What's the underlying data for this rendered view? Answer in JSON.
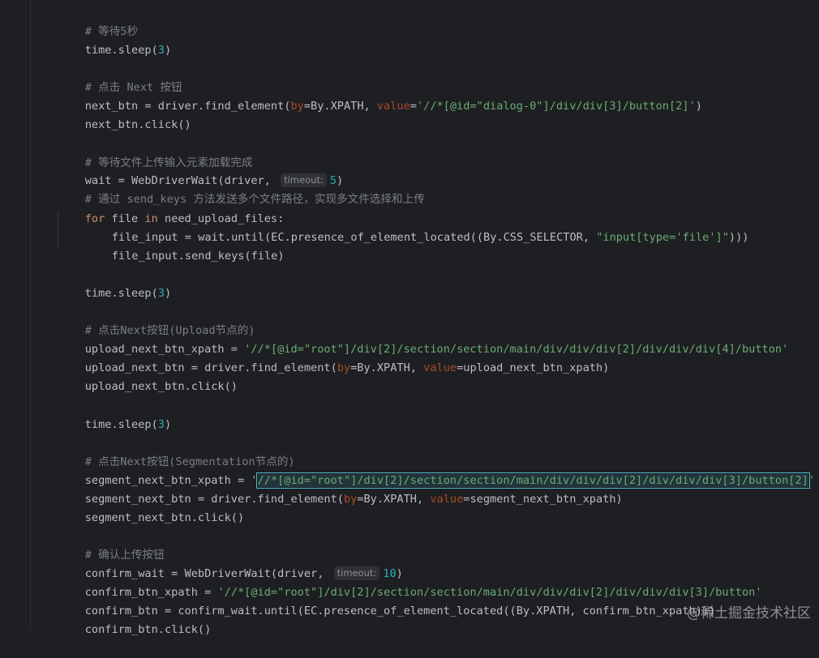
{
  "editor": {
    "lines": [
      {
        "parts": [
          "# 等待5秒"
        ]
      },
      {
        "parts": [
          "time.sleep(",
          "3",
          ")"
        ]
      },
      {
        "parts": [
          "# 点击 Next 按钮"
        ]
      },
      {
        "parts": [
          "next_btn = driver.find_element(",
          "by",
          "=By.XPATH, ",
          "value",
          "=",
          "'//*[@id=\"dialog-0\"]/div/div[3]/button[2]'",
          ")"
        ]
      },
      {
        "parts": [
          "next_btn.click()"
        ]
      },
      {
        "parts": [
          "# 等待文件上传输入元素加载完成"
        ]
      },
      {
        "parts": [
          "wait = WebDriverWait(driver, ",
          "timeout:",
          "5",
          ")"
        ]
      },
      {
        "parts": [
          "# 通过 send_keys 方法发送多个文件路径，实现多文件选择和上传"
        ]
      },
      {
        "parts": [
          "for",
          " file ",
          "in",
          " need_upload_files:"
        ]
      },
      {
        "parts": [
          "file_input = wait.until(EC.presence_of_element_located((By.CSS_SELECTOR, ",
          "\"input[type='file']\"",
          ")))"
        ]
      },
      {
        "parts": [
          "file_input.send_keys(file)"
        ]
      },
      {
        "parts": [
          "time.sleep(",
          "3",
          ")"
        ]
      },
      {
        "parts": [
          "# 点击Next按钮(Upload节点的)"
        ]
      },
      {
        "parts": [
          "upload_next_btn_xpath = ",
          "'//*[@id=\"root\"]/div[2]/section/section/main/div/div/div[2]/div/div/div[4]/button'"
        ]
      },
      {
        "parts": [
          "upload_next_btn = driver.find_element(",
          "by",
          "=By.XPATH, ",
          "value",
          "=upload_next_btn_xpath)"
        ]
      },
      {
        "parts": [
          "upload_next_btn.click()"
        ]
      },
      {
        "parts": [
          "time.sleep(",
          "3",
          ")"
        ]
      },
      {
        "parts": [
          "# 点击Next按钮(Segmentation节点的)"
        ]
      },
      {
        "parts": [
          "segment_next_btn_xpath = ",
          "'",
          "//*[@id=\"root\"]/div[2]/section/section/main/div/div/div[2]/div/div/div[3]/button[2]",
          "'"
        ]
      },
      {
        "parts": [
          "segment_next_btn = driver.find_element(",
          "by",
          "=By.XPATH, ",
          "value",
          "=segment_next_btn_xpath)"
        ]
      },
      {
        "parts": [
          "segment_next_btn.click()"
        ]
      },
      {
        "parts": [
          "# 确认上传按钮"
        ]
      },
      {
        "parts": [
          "confirm_wait = WebDriverWait(driver, ",
          "timeout:",
          "10",
          ")"
        ]
      },
      {
        "parts": [
          "confirm_btn_xpath = ",
          "'//*[@id=\"root\"]/div[2]/section/section/main/div/div/div[2]/div/div/div[3]/button'"
        ]
      },
      {
        "parts": [
          "confirm_btn = confirm_wait.until(EC.presence_of_element_located((By.XPATH, confirm_btn_xpath)))"
        ]
      },
      {
        "parts": [
          "confirm_btn.click()"
        ]
      }
    ]
  },
  "watermark": {
    "text": "@稀土掘金技术社区"
  },
  "colors": {
    "background": "#1e1f22",
    "text": "#bcbec4",
    "comment": "#7a7e85",
    "keyword": "#cf8e6d",
    "parameter": "#aa4926",
    "string": "#6aab73",
    "number": "#2aacb8",
    "selection_border": "#4fb7c8"
  }
}
